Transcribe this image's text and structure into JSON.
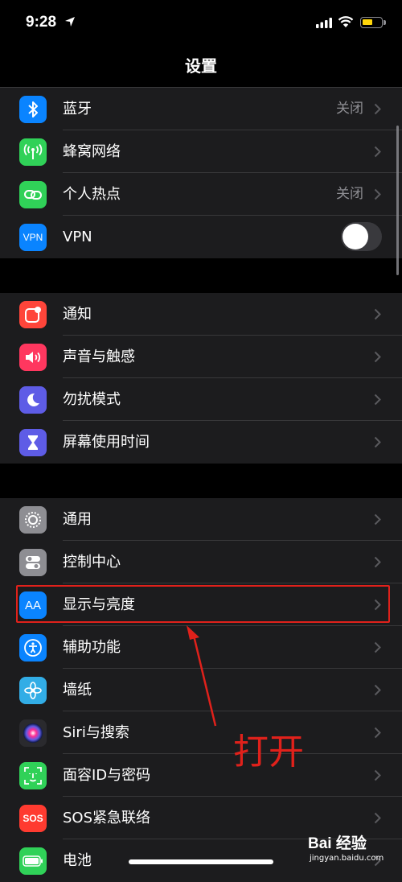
{
  "status": {
    "time": "9:28"
  },
  "nav": {
    "title": "设置"
  },
  "groups": [
    {
      "items": [
        {
          "label": "蓝牙",
          "value": "关闭",
          "icon": "bluetooth-icon",
          "color": "#0a84ff"
        },
        {
          "label": "蜂窝网络",
          "icon": "cellular-icon",
          "color": "#30d158"
        },
        {
          "label": "个人热点",
          "value": "关闭",
          "icon": "hotspot-icon",
          "color": "#30d158"
        },
        {
          "label": "VPN",
          "icon": "vpn-icon",
          "icon_text": "VPN",
          "color": "#0a84ff",
          "toggle": false
        }
      ]
    },
    {
      "items": [
        {
          "label": "通知",
          "icon": "notifications-icon",
          "color": "#ff453a"
        },
        {
          "label": "声音与触感",
          "icon": "speaker-icon",
          "color": "#ff375f"
        },
        {
          "label": "勿扰模式",
          "icon": "moon-icon",
          "color": "#5e5ce6"
        },
        {
          "label": "屏幕使用时间",
          "icon": "hourglass-icon",
          "color": "#5e5ce6"
        }
      ]
    },
    {
      "items": [
        {
          "label": "通用",
          "icon": "gear-icon",
          "color": "#8e8e93"
        },
        {
          "label": "控制中心",
          "icon": "switches-icon",
          "color": "#8e8e93"
        },
        {
          "label": "显示与亮度",
          "icon": "display-aa-icon",
          "icon_text": "AA",
          "color": "#0a84ff"
        },
        {
          "label": "辅助功能",
          "icon": "accessibility-icon",
          "color": "#0a84ff"
        },
        {
          "label": "墙纸",
          "icon": "wallpaper-icon",
          "color": "#32ade6"
        },
        {
          "label": "Siri与搜索",
          "icon": "siri-icon",
          "color": "#1c1c1e"
        },
        {
          "label": "面容ID与密码",
          "icon": "faceid-icon",
          "color": "#30d158"
        },
        {
          "label": "SOS紧急联络",
          "icon": "sos-icon",
          "icon_text": "SOS",
          "color": "#ff3b30"
        },
        {
          "label": "电池",
          "icon": "battery-icon",
          "color": "#30d158"
        }
      ]
    }
  ],
  "annotation": {
    "text": "打开",
    "color": "#e0211b"
  },
  "watermark": {
    "brand": "Bai  经验",
    "url": "jingyan.baidu.com"
  }
}
